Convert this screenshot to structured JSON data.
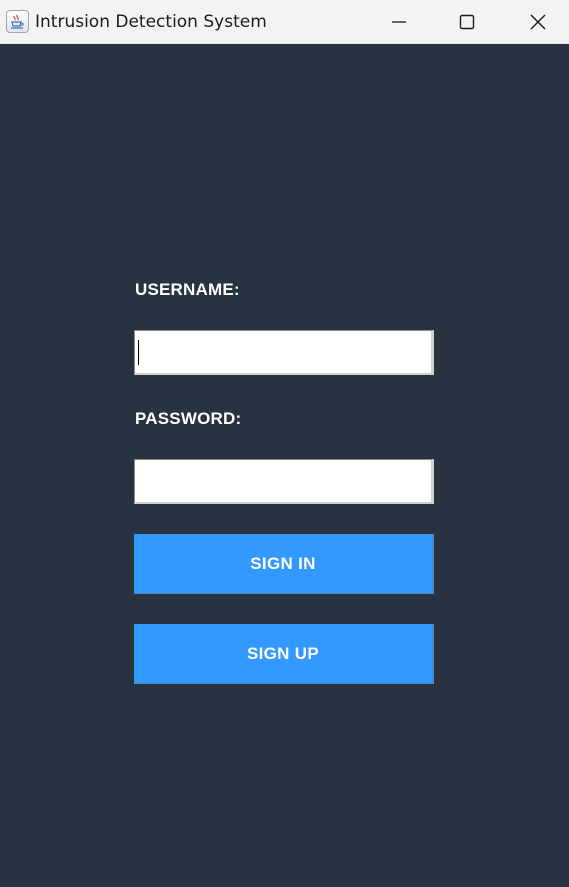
{
  "window": {
    "title": "Intrusion Detection System",
    "app_icon": "java-coffee-cup-icon",
    "controls": [
      "minimize-icon",
      "maximize-icon",
      "close-icon"
    ]
  },
  "login": {
    "username_label": "USERNAME:",
    "username_value": "",
    "password_label": "PASSWORD:",
    "password_value": "",
    "sign_in_label": "SIGN IN",
    "sign_up_label": "SIGN UP"
  },
  "colors": {
    "background": "#293240",
    "titlebar": "#f3f3f3",
    "button": "#3399ff",
    "label_text": "#ffffff"
  }
}
